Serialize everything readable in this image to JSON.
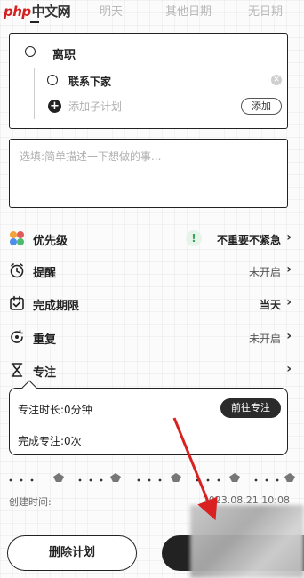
{
  "watermark": {
    "brand": "php",
    "cn": "中文网"
  },
  "date_tabs": [
    "明天",
    "其他日期",
    "无日期"
  ],
  "task": {
    "title": "离职",
    "subtasks": [
      {
        "title": "联系下家"
      }
    ],
    "add_subtask_placeholder": "添加子计划",
    "add_button": "添加"
  },
  "description": {
    "placeholder": "选填:简单描述一下想做的事..."
  },
  "settings": {
    "priority": {
      "label": "优先级",
      "value": "不重要不紧急",
      "indicator": "!"
    },
    "reminder": {
      "label": "提醒",
      "value": "未开启"
    },
    "deadline": {
      "label": "完成期限",
      "value": "当天"
    },
    "repeat": {
      "label": "重复",
      "value": "未开启"
    },
    "focus": {
      "label": "专注"
    }
  },
  "focus_card": {
    "duration_label": "专注时长:",
    "duration_value": "0分钟",
    "completed_label": "完成专注:",
    "completed_value": "0次",
    "goto_button": "前往专注"
  },
  "created": {
    "label": "创建时间:",
    "value": "2023.08.21 10:08"
  },
  "bottom": {
    "delete_button": "删除计划"
  },
  "colors": {
    "accent_dark": "#222222",
    "annotation_arrow": "#d92121",
    "priority_green": "#3aa35b"
  }
}
